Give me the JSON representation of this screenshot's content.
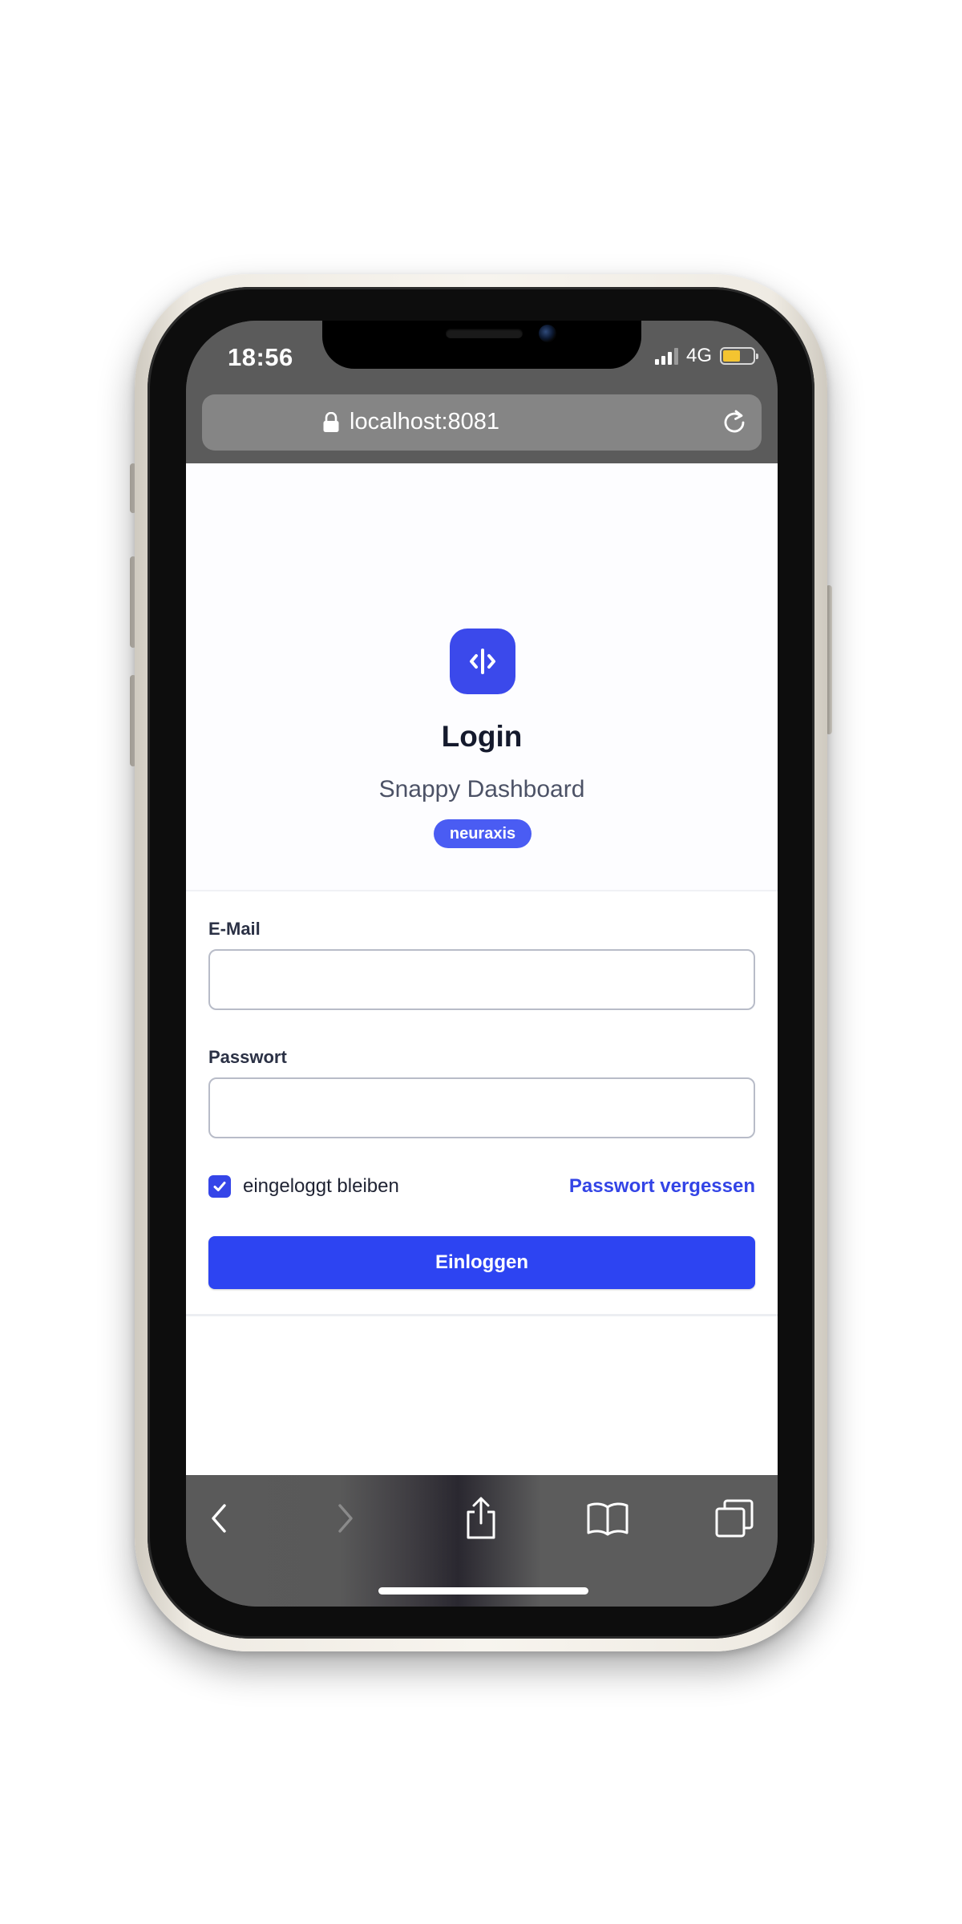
{
  "status_bar": {
    "time": "18:56",
    "network": "4G",
    "battery_level": 0.58
  },
  "browser": {
    "url": "localhost:8081",
    "icons": [
      "lock-icon",
      "reload-icon",
      "back-icon",
      "forward-icon",
      "share-icon",
      "bookmarks-icon",
      "tabs-icon"
    ]
  },
  "page": {
    "title": "Login",
    "subtitle": "Snappy Dashboard",
    "tag": "neuraxis",
    "logo_icon": "code-brackets-icon"
  },
  "form": {
    "email_label": "E-Mail",
    "email_value": "",
    "password_label": "Passwort",
    "password_value": "",
    "remember_label": "eingeloggt bleiben",
    "remember_checked": true,
    "forgot_label": "Passwort vergessen",
    "submit_label": "Einloggen"
  },
  "colors": {
    "accent": "#2d44f2",
    "badge": "#4a5cf3",
    "logo": "#3b49eb"
  }
}
